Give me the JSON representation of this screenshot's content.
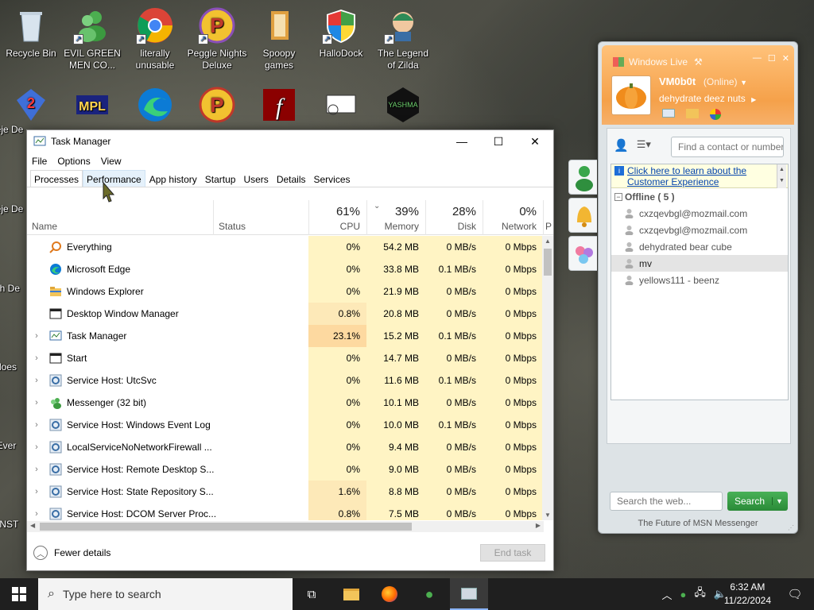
{
  "desktop": {
    "icons": [
      {
        "label": "Recycle Bin"
      },
      {
        "label": "EVIL GREEN MEN CO..."
      },
      {
        "label": "literally unusable"
      },
      {
        "label": "Peggle Nights Deluxe"
      },
      {
        "label": "Spoopy games"
      },
      {
        "label": "HalloDock"
      },
      {
        "label": "The Legend of Zilda"
      }
    ],
    "row2_icons": [
      "Bejeweled",
      "MPL",
      "Edge",
      "Peggle",
      "Flash",
      "RDP",
      "YASHMA"
    ],
    "left_partial_labels": [
      "Beje De",
      "Beje De",
      "Ch De",
      "does",
      "Ever",
      "!INST"
    ],
    "yashma_logo_text": "YASHMA"
  },
  "taskmgr": {
    "title": "Task Manager",
    "menu": [
      "File",
      "Options",
      "View"
    ],
    "tabs": [
      "Processes",
      "Performance",
      "App history",
      "Startup",
      "Users",
      "Details",
      "Services"
    ],
    "columns": {
      "name": "Name",
      "status": "Status",
      "cpu": {
        "pct": "61%",
        "label": "CPU"
      },
      "memory": {
        "pct": "39%",
        "label": "Memory"
      },
      "disk": {
        "pct": "28%",
        "label": "Disk"
      },
      "network": {
        "pct": "0%",
        "label": "Network"
      },
      "power": {
        "label": "P"
      }
    },
    "processes": [
      {
        "name": "Everything",
        "cpu": "0%",
        "mem": "54.2 MB",
        "disk": "0 MB/s",
        "net": "0 Mbps",
        "expandable": false,
        "icon": "search-app-icon"
      },
      {
        "name": "Microsoft Edge",
        "cpu": "0%",
        "mem": "33.8 MB",
        "disk": "0.1 MB/s",
        "net": "0 Mbps",
        "expandable": false,
        "icon": "edge-icon"
      },
      {
        "name": "Windows Explorer",
        "cpu": "0%",
        "mem": "21.9 MB",
        "disk": "0 MB/s",
        "net": "0 Mbps",
        "expandable": false,
        "icon": "folder-icon"
      },
      {
        "name": "Desktop Window Manager",
        "cpu": "0.8%",
        "mem": "20.8 MB",
        "disk": "0 MB/s",
        "net": "0 Mbps",
        "expandable": false,
        "icon": "window-icon"
      },
      {
        "name": "Task Manager",
        "cpu": "23.1%",
        "mem": "15.2 MB",
        "disk": "0.1 MB/s",
        "net": "0 Mbps",
        "expandable": true,
        "icon": "taskmgr-icon"
      },
      {
        "name": "Start",
        "cpu": "0%",
        "mem": "14.7 MB",
        "disk": "0 MB/s",
        "net": "0 Mbps",
        "expandable": true,
        "icon": "window-icon"
      },
      {
        "name": "Service Host: UtcSvc",
        "cpu": "0%",
        "mem": "11.6 MB",
        "disk": "0.1 MB/s",
        "net": "0 Mbps",
        "expandable": true,
        "icon": "gear-icon"
      },
      {
        "name": "Messenger (32 bit)",
        "cpu": "0%",
        "mem": "10.1 MB",
        "disk": "0 MB/s",
        "net": "0 Mbps",
        "expandable": true,
        "icon": "messenger-icon"
      },
      {
        "name": "Service Host: Windows Event Log",
        "cpu": "0%",
        "mem": "10.0 MB",
        "disk": "0.1 MB/s",
        "net": "0 Mbps",
        "expandable": true,
        "icon": "gear-icon"
      },
      {
        "name": "LocalServiceNoNetworkFirewall ...",
        "cpu": "0%",
        "mem": "9.4 MB",
        "disk": "0 MB/s",
        "net": "0 Mbps",
        "expandable": true,
        "icon": "gear-icon"
      },
      {
        "name": "Service Host: Remote Desktop S...",
        "cpu": "0%",
        "mem": "9.0 MB",
        "disk": "0 MB/s",
        "net": "0 Mbps",
        "expandable": true,
        "icon": "gear-icon"
      },
      {
        "name": "Service Host: State Repository S...",
        "cpu": "1.6%",
        "mem": "8.8 MB",
        "disk": "0 MB/s",
        "net": "0 Mbps",
        "expandable": true,
        "icon": "gear-icon"
      },
      {
        "name": "Service Host: DCOM Server Proc...",
        "cpu": "0.8%",
        "mem": "7.5 MB",
        "disk": "0 MB/s",
        "net": "0 Mbps",
        "expandable": true,
        "icon": "gear-icon"
      }
    ],
    "fewer_details": "Fewer details",
    "end_task": "End task"
  },
  "msn": {
    "title": "Windows Live",
    "username": "VM0b0t",
    "status": "(Online)",
    "personal_message": "dehydrate deez nuts",
    "search_contacts_placeholder": "Find a contact or number",
    "banner_line1": "Click here to learn about the",
    "banner_line2": "Customer Experience",
    "group_label": "Offline ( 5 )",
    "contacts": [
      {
        "name": "cxzqevbgl@mozmail.com",
        "selected": false
      },
      {
        "name": "cxzqevbgl@mozmail.com",
        "selected": false
      },
      {
        "name": "dehydrated bear cube",
        "selected": false
      },
      {
        "name": "mv",
        "selected": true
      },
      {
        "name": "yellows111 - beenz",
        "selected": false
      }
    ],
    "web_search_placeholder": "Search the web...",
    "search_button": "Search",
    "footer": "The Future of MSN Messenger"
  },
  "taskbar": {
    "search_placeholder": "Type here to search",
    "time": "6:32 AM",
    "date": "11/22/2024"
  },
  "colors": {
    "cpu_highlight": "#fdd9a0",
    "column_tint": "#fff4c4",
    "msn_orange": "#f5a14a",
    "search_green": "#2f9a3e"
  }
}
